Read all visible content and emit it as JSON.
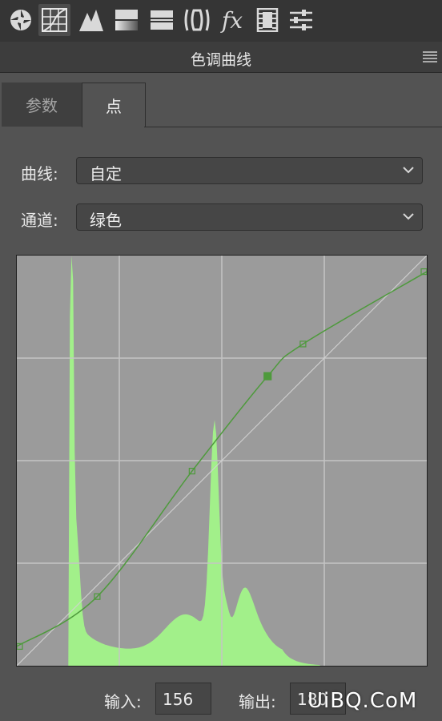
{
  "toolbar": {
    "icons": [
      "aperture-icon",
      "curves-icon",
      "mountains-icon",
      "gradient-icon",
      "split-toning-icon",
      "lens-icon",
      "fx-icon",
      "film-strip-icon",
      "sliders-icon"
    ],
    "fx_label": "fx",
    "active_index": 1
  },
  "panel": {
    "title": "色调曲线"
  },
  "tabs": [
    {
      "label": "参数",
      "active": false
    },
    {
      "label": "点",
      "active": true
    }
  ],
  "curve_select": {
    "label": "曲线:",
    "value": "自定"
  },
  "channel_select": {
    "label": "通道:",
    "value": "绿色"
  },
  "graph": {
    "histogram_color": "#a2f08a",
    "curve_color": "#4e9a3c",
    "background_color": "#9b9b9b",
    "control_points": [
      {
        "input": 0,
        "output": 12
      },
      {
        "input": 50,
        "output": 43
      },
      {
        "input": 109,
        "output": 121
      },
      {
        "input": 156,
        "output": 180
      },
      {
        "input": 178,
        "output": 200
      },
      {
        "input": 255,
        "output": 245
      }
    ],
    "selected_point_index": 3,
    "histogram_peaks": [
      {
        "at": 34,
        "level": 1.0
      },
      {
        "at": 123,
        "level": 0.53
      },
      {
        "at": 141,
        "level": 0.13
      }
    ]
  },
  "io": {
    "input_label": "输入:",
    "input_value": "156",
    "output_label": "输出:",
    "output_value": "180"
  },
  "watermark": "UiBQ.CoM"
}
